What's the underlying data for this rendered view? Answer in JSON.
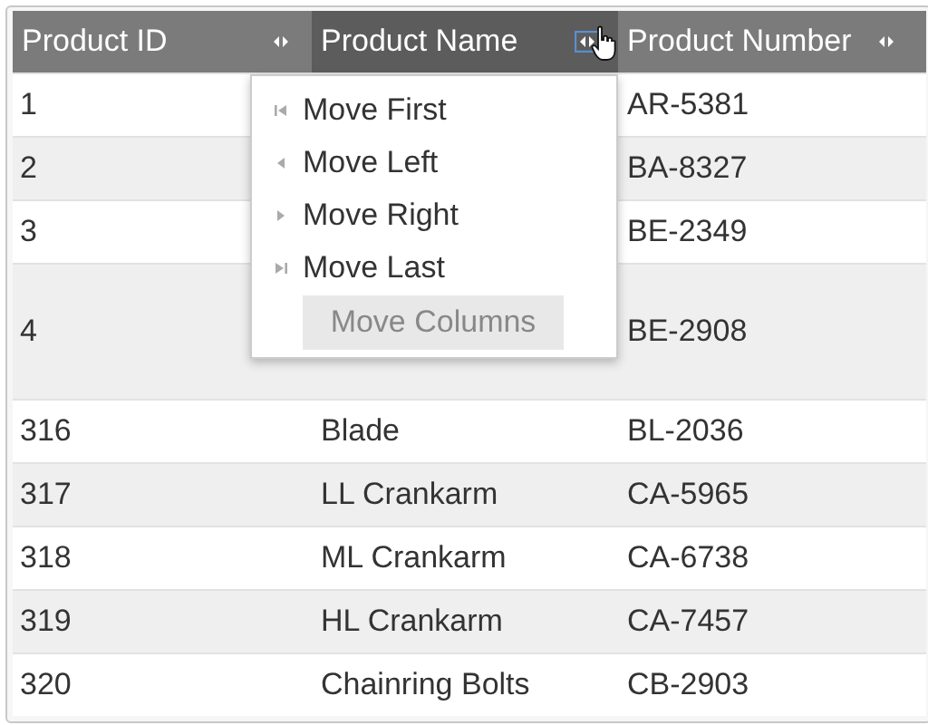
{
  "table": {
    "columns": [
      {
        "label": "Product ID",
        "selected": false,
        "focused": false
      },
      {
        "label": "Product Name",
        "selected": true,
        "focused": true
      },
      {
        "label": "Product Number",
        "selected": false,
        "focused": false
      }
    ],
    "rows": [
      {
        "id": "1",
        "number": "AR-5381"
      },
      {
        "id": "2",
        "number": "BA-8327"
      },
      {
        "id": "3",
        "number": "BE-2349"
      },
      {
        "id": "4",
        "number": "BE-2908",
        "tall": true
      },
      {
        "id": "316",
        "name": "Blade",
        "number": "BL-2036"
      },
      {
        "id": "317",
        "name": "LL Crankarm",
        "number": "CA-5965"
      },
      {
        "id": "318",
        "name": "ML Crankarm",
        "number": "CA-6738"
      },
      {
        "id": "319",
        "name": "HL Crankarm",
        "number": "CA-7457"
      },
      {
        "id": "320",
        "name": "Chainring Bolts",
        "number": "CB-2903"
      }
    ]
  },
  "menu": {
    "items": [
      {
        "label": "Move First",
        "kind": "first"
      },
      {
        "label": "Move Left",
        "kind": "left"
      },
      {
        "label": "Move Right",
        "kind": "right"
      },
      {
        "label": "Move Last",
        "kind": "last"
      }
    ],
    "button": "Move Columns"
  }
}
